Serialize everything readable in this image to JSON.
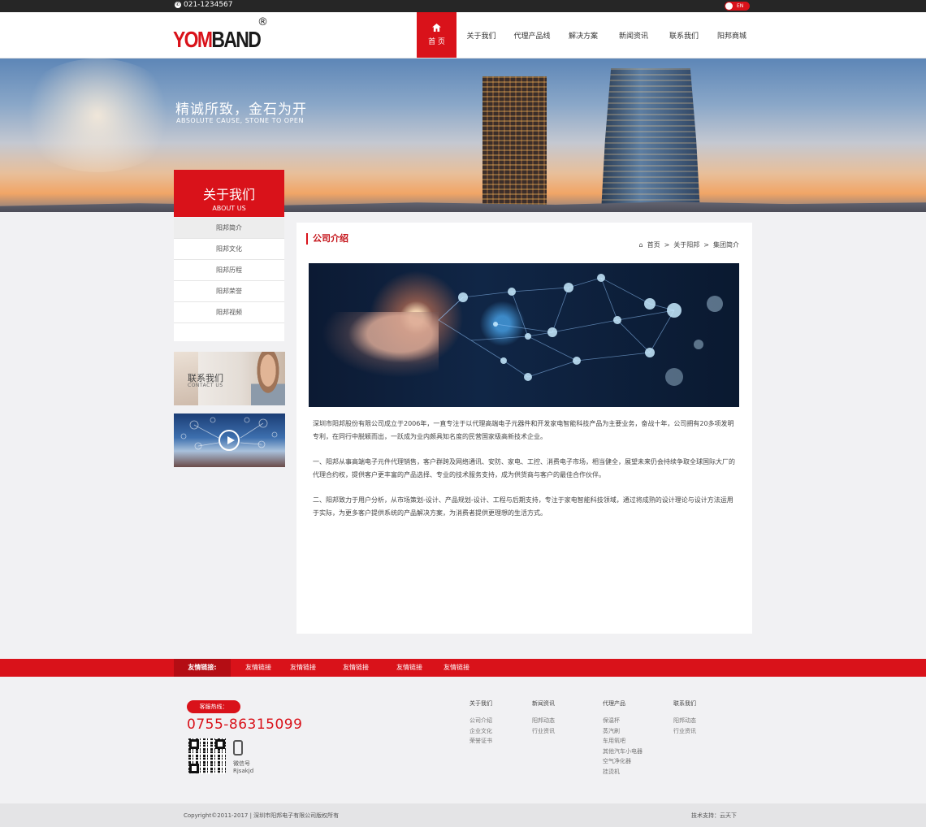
{
  "topbar": {
    "phone": "021-1234567",
    "lang": "EN"
  },
  "header": {
    "logo": {
      "red": "YOM",
      "black": "BAND",
      "reg": "®"
    },
    "nav": [
      {
        "label": "首 页",
        "active": true
      },
      {
        "label": "关于我们"
      },
      {
        "label": "代理产品线"
      },
      {
        "label": "解决方案"
      },
      {
        "label": "新闻资讯"
      },
      {
        "label": "联系我们"
      },
      {
        "label": "阳邦商城"
      }
    ]
  },
  "banner": {
    "slogan": "精诚所致，金石为开",
    "slogan_en": "ABSOLUTE CAUSE, STONE TO OPEN"
  },
  "sidebar": {
    "title": "关于我们",
    "title_en": "ABOUT US",
    "items": [
      "阳邦简介",
      "阳邦文化",
      "阳邦历程",
      "阳邦荣誉",
      "阳邦视频"
    ],
    "contact": {
      "cn": "联系我们",
      "en": "CONTACT US"
    }
  },
  "main": {
    "title": "公司介绍",
    "breadcrumb": [
      "首页",
      ">",
      "关于阳邦",
      ">",
      "集团简介"
    ],
    "paragraphs": [
      "深圳市阳邦股份有限公司成立于2006年，一直专注于以代理高端电子元器件和开发家电智能科技产品为主要业务，奋战十年，公司拥有20多项发明专利，在同行中脱颖而出，一跃成为业内颇具知名度的民营国家级高新技术企业。",
      "一、阳邦从事高端电子元件代理销售，客户群跨及网络通讯、安防、家电、工控、消费电子市场，相当健全，展望未来仍会持续争取全球国际大厂的代理合约权，提供客户更丰富的产品选择、专业的技术服务支持，成为供货商与客户的最佳合作伙伴。",
      "二、阳邦致力于用户分析，从市场策划-设计、产品规划-设计、工程与后期支持，专注于家电智能科技领域，通过将成熟的设计理论与设计方法运用于实际，为更多客户提供系统的产品解决方案，为消费者提供更理想的生活方式。"
    ]
  },
  "links": {
    "label": "友情链接:",
    "items": [
      "友情链接",
      "友情链接",
      "友情链接",
      "友情链接",
      "友情链接"
    ]
  },
  "footer": {
    "hotline_label": "客服热线：",
    "hotline": "0755-86315099",
    "wechat_label": "微信号",
    "wechat_id": "Rjsakjd",
    "columns": [
      {
        "title": "关于我们",
        "items": [
          "公司介绍",
          "企业文化",
          "荣誉证书"
        ]
      },
      {
        "title": "新闻资讯",
        "items": [
          "阳邦动态",
          "行业资讯"
        ]
      },
      {
        "title": "代理产品",
        "items": [
          "保温杯",
          "蒸汽刷",
          "车用氧吧",
          "其他汽车小电器",
          "空气净化器",
          "挂烫机"
        ]
      },
      {
        "title": "联系我们",
        "items": [
          "阳邦动态",
          "行业资讯"
        ]
      }
    ],
    "copyright": "Copyright©2011-2017 | 深圳市阳邦电子有限公司版权所有",
    "tech": "技术支持：云天下"
  },
  "colors": {
    "brand_red": "#d9121a",
    "dark": "#262626"
  }
}
